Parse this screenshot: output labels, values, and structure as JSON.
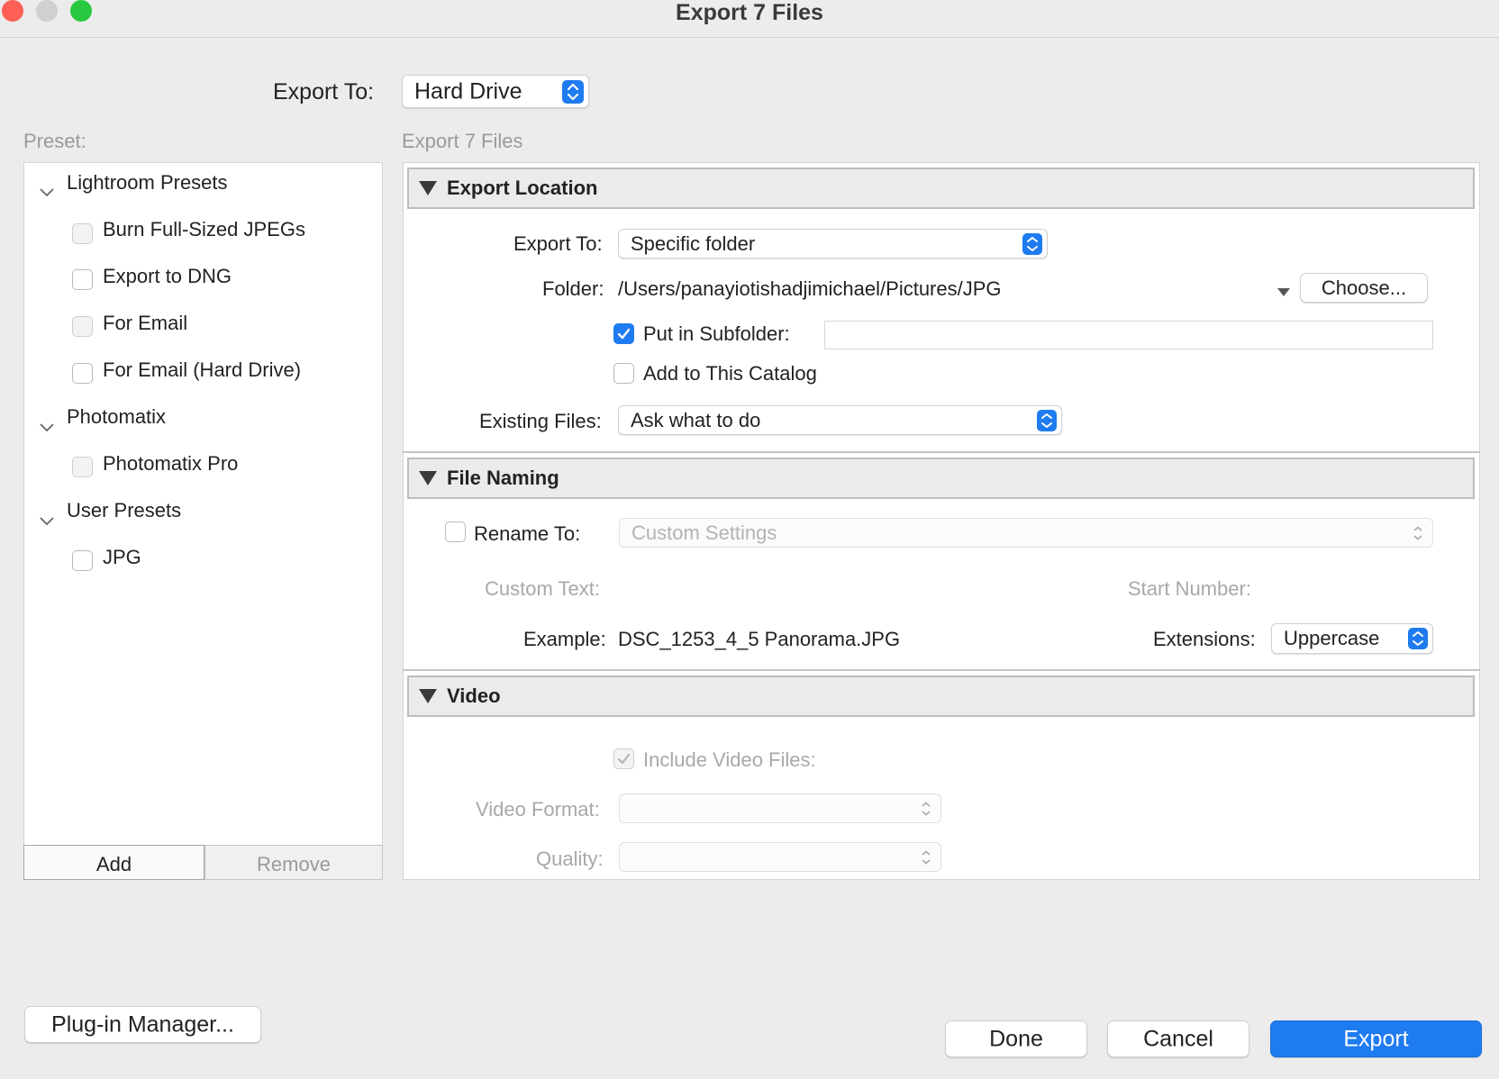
{
  "window": {
    "title": "Export 7 Files"
  },
  "export_to": {
    "label": "Export To:",
    "value": "Hard Drive"
  },
  "preset": {
    "label": "Preset:",
    "groups": [
      {
        "name": "Lightroom Presets",
        "items": [
          "Burn Full-Sized JPEGs",
          "Export to DNG",
          "For Email",
          "For Email (Hard Drive)"
        ]
      },
      {
        "name": "Photomatix",
        "items": [
          "Photomatix Pro"
        ]
      },
      {
        "name": "User Presets",
        "items": [
          "JPG"
        ]
      }
    ],
    "add_label": "Add",
    "remove_label": "Remove"
  },
  "settings_header": "Export 7 Files",
  "export_location": {
    "title": "Export Location",
    "export_to_label": "Export To:",
    "export_to_value": "Specific folder",
    "folder_label": "Folder:",
    "folder_path": "/Users/panayiotishadjimichael/Pictures/JPG",
    "choose_label": "Choose...",
    "subfolder_label": "Put in Subfolder:",
    "subfolder_value": "",
    "subfolder_checked": true,
    "add_catalog_label": "Add to This Catalog",
    "add_catalog_checked": false,
    "existing_files_label": "Existing Files:",
    "existing_files_value": "Ask what to do"
  },
  "file_naming": {
    "title": "File Naming",
    "rename_label": "Rename To:",
    "rename_checked": false,
    "rename_value": "Custom Settings",
    "custom_text_label": "Custom Text:",
    "start_number_label": "Start Number:",
    "example_label": "Example:",
    "example_value": "DSC_1253_4_5 Panorama.JPG",
    "extensions_label": "Extensions:",
    "extensions_value": "Uppercase"
  },
  "video": {
    "title": "Video",
    "include_label": "Include Video Files:",
    "include_checked": true,
    "format_label": "Video Format:",
    "format_value": "",
    "quality_label": "Quality:",
    "quality_value": ""
  },
  "footer": {
    "plugin_manager_label": "Plug-in Manager...",
    "done_label": "Done",
    "cancel_label": "Cancel",
    "export_label": "Export"
  },
  "colors": {
    "accent": "#1f7bf0",
    "close": "#fe5f57",
    "minimize": "#d0d0d0",
    "zoom": "#28c840"
  }
}
